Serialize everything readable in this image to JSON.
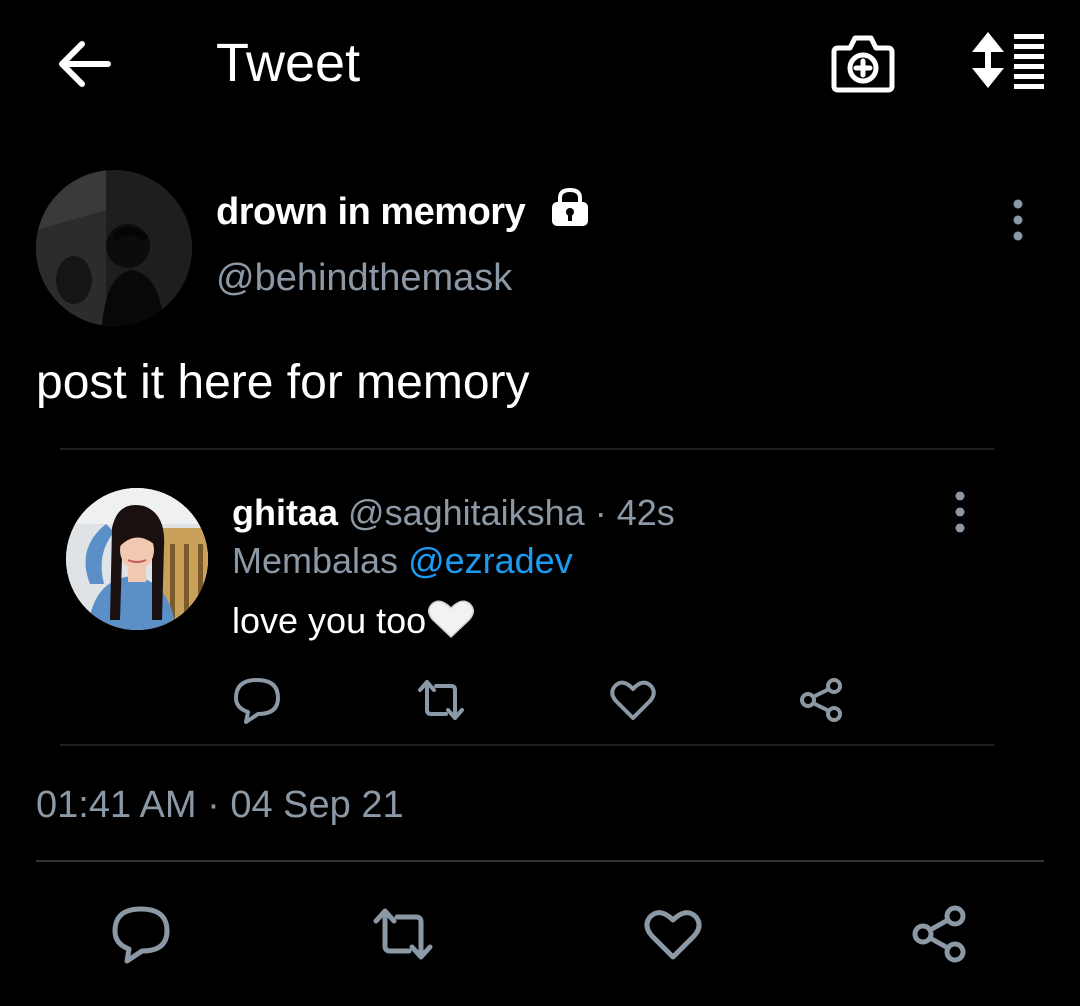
{
  "header": {
    "title": "Tweet",
    "icons": {
      "back": "arrow-left-icon",
      "camera": "camera-plus-icon",
      "sort": "sort-icon"
    }
  },
  "tweet": {
    "display_name": "drown in memory",
    "protected": true,
    "handle": "@behindthemask",
    "text": "post it here for memory",
    "timestamp": "01:41 AM · 04 Sep 21"
  },
  "reply": {
    "name": "ghitaa",
    "handle": "@saghitaiksha",
    "separator": "·",
    "time": "42s",
    "replying_label": "Membalas",
    "mention": "@ezradev",
    "text": "love you too",
    "emoji": "white-heart"
  },
  "actions": [
    "reply",
    "retweet",
    "like",
    "share"
  ],
  "colors": {
    "background": "#000000",
    "text_primary": "#ffffff",
    "text_secondary": "#8b98a5",
    "link": "#1d9bf0",
    "divider": "#2f3336",
    "icon": "#8b98a5"
  }
}
